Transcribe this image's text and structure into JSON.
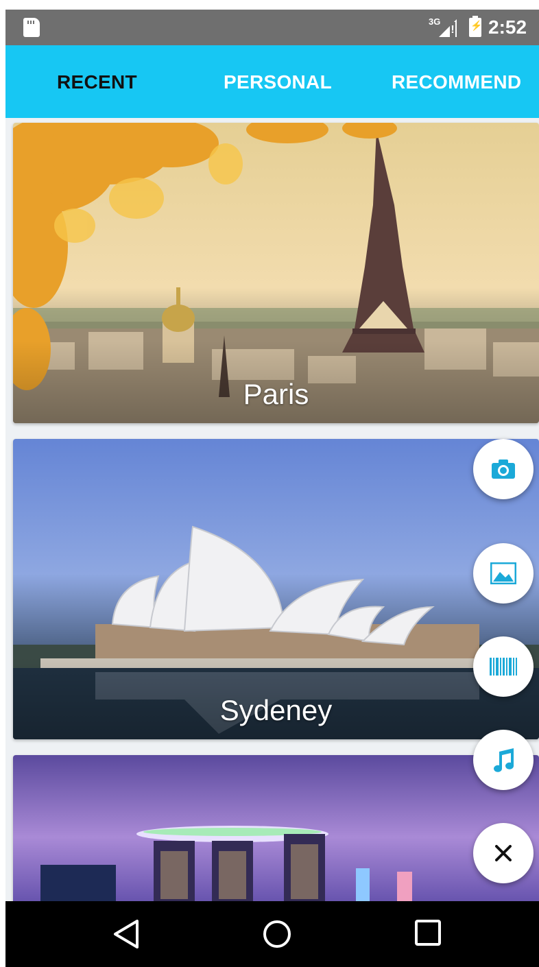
{
  "status_bar": {
    "network": "3G",
    "time": "2:52",
    "icons": [
      "sd-card-icon",
      "signal-icon",
      "battery-charging-icon"
    ]
  },
  "tabs": [
    {
      "label": "RECENT",
      "active": true
    },
    {
      "label": "PERSONAL",
      "active": false
    },
    {
      "label": "RECOMMEND",
      "active": false
    }
  ],
  "cards": [
    {
      "caption": "Paris"
    },
    {
      "caption": "Sydeney"
    },
    {
      "caption": ""
    }
  ],
  "fab_menu": {
    "actions": [
      "camera-icon",
      "image-icon",
      "barcode-icon",
      "music-icon"
    ],
    "close_icon": "close-icon"
  },
  "nav_bar": {
    "buttons": [
      "back-icon",
      "home-icon",
      "recents-icon"
    ]
  },
  "colors": {
    "accent": "#17c7f3",
    "active_tab_text": "#111111",
    "inactive_tab_text": "#ffffff",
    "fab_icon": "#1ba9d8"
  }
}
